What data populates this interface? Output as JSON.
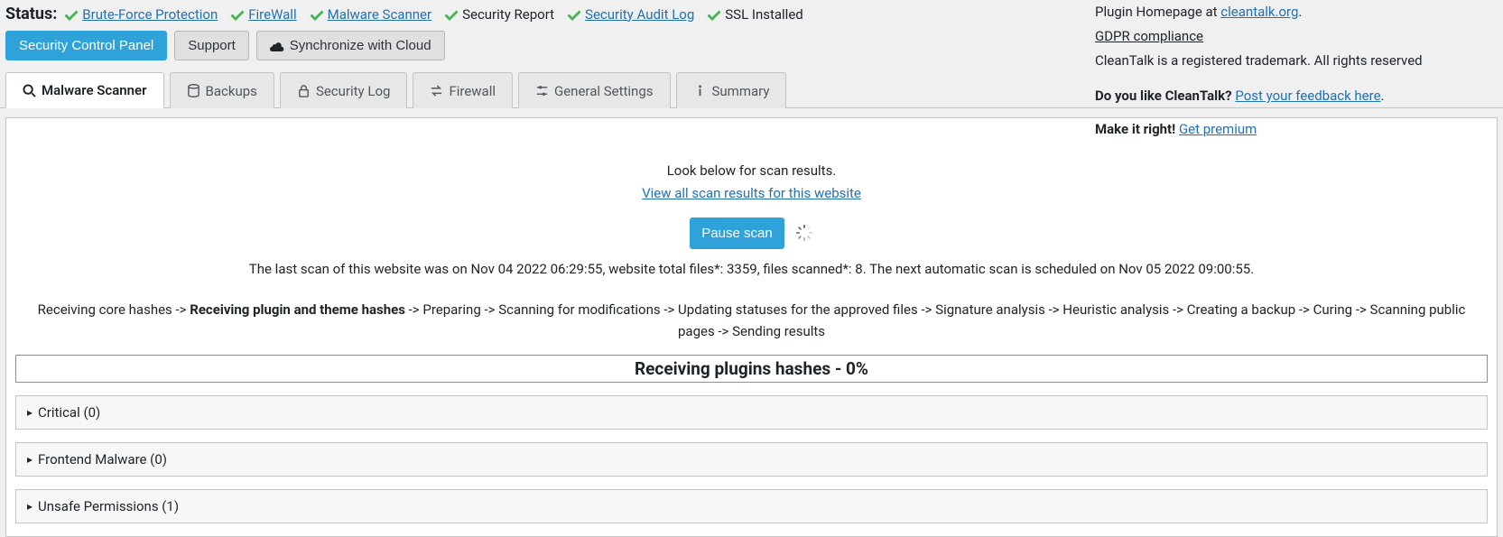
{
  "status": {
    "label": "Status:",
    "items": [
      {
        "label": "Brute-Force Protection",
        "link": true
      },
      {
        "label": "FireWall",
        "link": true
      },
      {
        "label": "Malware Scanner",
        "link": true
      },
      {
        "label": "Security Report",
        "link": false
      },
      {
        "label": "Security Audit Log",
        "link": true
      },
      {
        "label": "SSL Installed",
        "link": false
      }
    ]
  },
  "actions": {
    "control_panel": "Security Control Panel",
    "support": "Support",
    "sync": "Synchronize with Cloud"
  },
  "sidebar": {
    "homepage_prefix": "Plugin Homepage at ",
    "homepage_link": "cleantalk.org",
    "homepage_suffix": ".",
    "gdpr": "GDPR compliance",
    "trademark": "CleanTalk is a registered trademark. All rights reserved",
    "like_prefix": "Do you like CleanTalk? ",
    "like_link": "Post your feedback here",
    "like_suffix": ".",
    "premium_prefix": "Make it right! ",
    "premium_link": "Get premium"
  },
  "tabs": {
    "scanner": "Malware Scanner",
    "backups": "Backups",
    "seclog": "Security Log",
    "firewall": "Firewall",
    "general": "General Settings",
    "summary": "Summary"
  },
  "scan": {
    "look_below": "Look below for scan results.",
    "view_all": "View all scan results for this website",
    "pause": "Pause scan",
    "last_scan": "The last scan of this website was on Nov 04 2022 06:29:55, website total files*: 3359, files scanned*: 8. The next automatic scan is scheduled on Nov 05 2022 09:00:55.",
    "stages": {
      "s1": "Receiving core hashes",
      "s2": "Receiving plugin and theme hashes",
      "s3": "Preparing",
      "s4": "Scanning for modifications",
      "s5": "Updating statuses for the approved files",
      "s6": "Signature analysis",
      "s7": "Heuristic analysis",
      "s8": "Creating a backup",
      "s9": "Curing",
      "s10": "Scanning public pages",
      "s11": "Sending results"
    },
    "sep": " -> ",
    "progress": "Receiving plugins hashes - 0%"
  },
  "accordions": {
    "critical": "Critical (0)",
    "frontend": "Frontend Malware (0)",
    "unsafe": "Unsafe Permissions (1)"
  }
}
